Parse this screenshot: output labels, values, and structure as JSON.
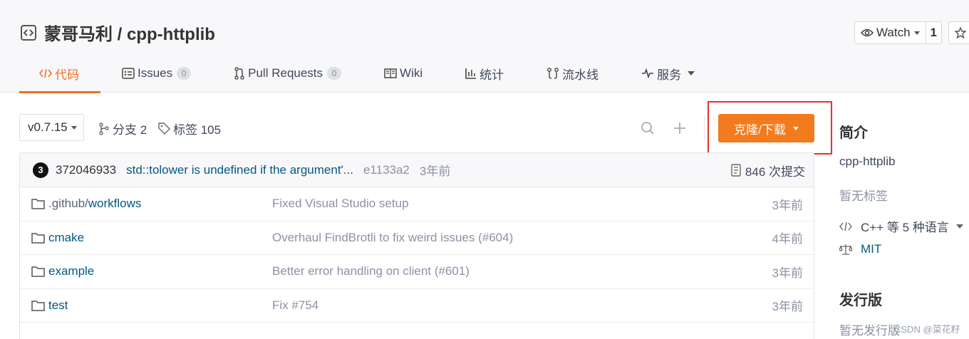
{
  "repo": {
    "title": "蒙哥马利 / cpp-httplib"
  },
  "watch": {
    "label": "Watch",
    "count": "1"
  },
  "tabs": [
    {
      "label": "代码",
      "badge": ""
    },
    {
      "label": "Issues",
      "badge": "0"
    },
    {
      "label": "Pull Requests",
      "badge": "0"
    },
    {
      "label": "Wiki",
      "badge": ""
    },
    {
      "label": "统计",
      "badge": ""
    },
    {
      "label": "流水线",
      "badge": ""
    },
    {
      "label": "服务",
      "badge": ""
    }
  ],
  "branch": {
    "selected": "v0.7.15",
    "branches": "分支 2",
    "tags": "标签 105"
  },
  "clone": {
    "label": "克隆/下载"
  },
  "commit": {
    "avatar": "3",
    "author": "372046933",
    "message": "std::tolower is undefined if the argument'...",
    "sha": "e1133a2",
    "time": "3年前",
    "count": "846 次提交"
  },
  "files": [
    {
      "dir_prefix": ".github/",
      "name": "workflows",
      "message": "Fixed Visual Studio setup",
      "time": "3年前"
    },
    {
      "dir_prefix": "",
      "name": "cmake",
      "message": "Overhaul FindBrotli to fix weird issues (#604)",
      "time": "4年前"
    },
    {
      "dir_prefix": "",
      "name": "example",
      "message": "Better error handling on client (#601)",
      "time": "3年前"
    },
    {
      "dir_prefix": "",
      "name": "test",
      "message": "Fix #754",
      "time": "3年前"
    }
  ],
  "sidebar": {
    "intro_heading": "简介",
    "description": "cpp-httplib",
    "no_tags": "暂无标签",
    "languages": "C++ 等 5 种语言",
    "license": "MIT",
    "release_heading": "发行版",
    "no_release": "暂无发行版"
  },
  "watermark": "CSDN @菜花籽",
  "colors": {
    "accent": "#f37b1d",
    "link": "#005980",
    "highlight": "#e3342f"
  }
}
